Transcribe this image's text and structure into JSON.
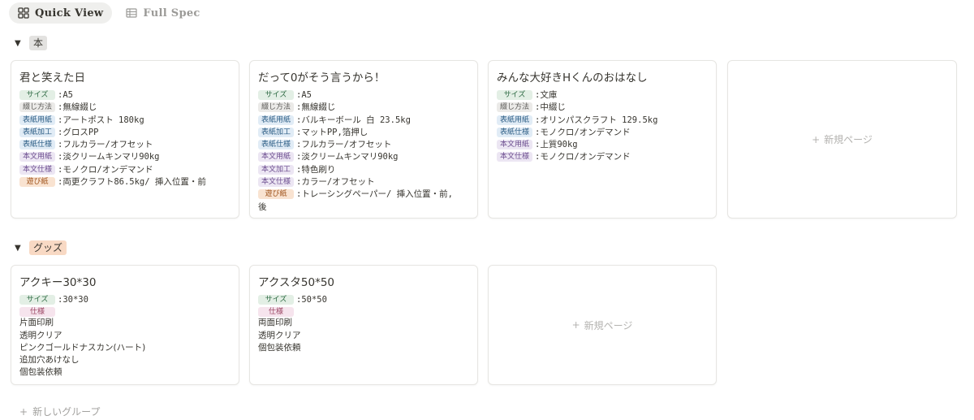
{
  "tabs": [
    {
      "label": "Quick View",
      "icon": "gallery-grid-icon",
      "active": true
    },
    {
      "label": "Full Spec",
      "icon": "table-icon",
      "active": false
    }
  ],
  "groups": {
    "books": {
      "name": "本",
      "color": "#e3e2e0"
    },
    "goods": {
      "name": "グッズ",
      "color": "#f8d9c4"
    }
  },
  "book_cards": [
    {
      "title": "君と笑えた日",
      "props": [
        {
          "label": "サイズ",
          "value": "A5"
        },
        {
          "label": "綴じ方法",
          "value": "無線綴じ"
        },
        {
          "label": "表紙用紙",
          "value": "アートポスト 180kg"
        },
        {
          "label": "表紙加工",
          "value": "グロスPP"
        },
        {
          "label": "表紙仕様",
          "value": "フルカラー/オフセット"
        },
        {
          "label": "本文用紙",
          "value": "淡クリームキンマリ90kg"
        },
        {
          "label": "本文仕様",
          "value": "モノクロ/オンデマンド"
        },
        {
          "label": "遊び紙",
          "value": "両更クラフト86.5kg/ 挿入位置・前"
        }
      ]
    },
    {
      "title": "だって0がそう言うから！",
      "props": [
        {
          "label": "サイズ",
          "value": "A5"
        },
        {
          "label": "綴じ方法",
          "value": "無線綴じ"
        },
        {
          "label": "表紙用紙",
          "value": "バルキーボール 白 23.5kg"
        },
        {
          "label": "表紙加工",
          "value": "マットPP,箔押し"
        },
        {
          "label": "表紙仕様",
          "value": "フルカラー/オフセット"
        },
        {
          "label": "本文用紙",
          "value": "淡クリームキンマリ90kg"
        },
        {
          "label": "本文加工",
          "value": "特色刷り"
        },
        {
          "label": "本文仕様",
          "value": "カラー/オフセット"
        },
        {
          "label": "遊び紙",
          "value": "トレーシングペーパー/ 挿入位置・前,",
          "wrap": "後"
        }
      ]
    },
    {
      "title": "みんな大好きHくんのおはなし",
      "props": [
        {
          "label": "サイズ",
          "value": "文庫"
        },
        {
          "label": "綴じ方法",
          "value": "中綴じ"
        },
        {
          "label": "表紙用紙",
          "value": "オリンパスクラフト 129.5kg"
        },
        {
          "label": "表紙仕様",
          "value": "モノクロ/オンデマンド"
        },
        {
          "label": "本文用紙",
          "value": "上質90kg"
        },
        {
          "label": "本文仕様",
          "value": "モノクロ/オンデマンド"
        }
      ]
    }
  ],
  "goods_cards": [
    {
      "title": "アクキー30*30",
      "size_label": "サイズ",
      "size": "30*30",
      "spec_label": "仕様",
      "spec_lines": [
        "片面印刷",
        "透明クリア",
        "ピンクゴールドナスカン(ハート)",
        "追加穴あけなし",
        "個包装依頼"
      ]
    },
    {
      "title": "アクスタ50*50",
      "size_label": "サイズ",
      "size": "50*50",
      "spec_label": "仕様",
      "spec_lines": [
        "両面印刷",
        "透明クリア",
        "個包装依頼"
      ]
    }
  ],
  "new_page_label": "新規ページ",
  "new_group_label": "新しいグループ",
  "sep": ":"
}
